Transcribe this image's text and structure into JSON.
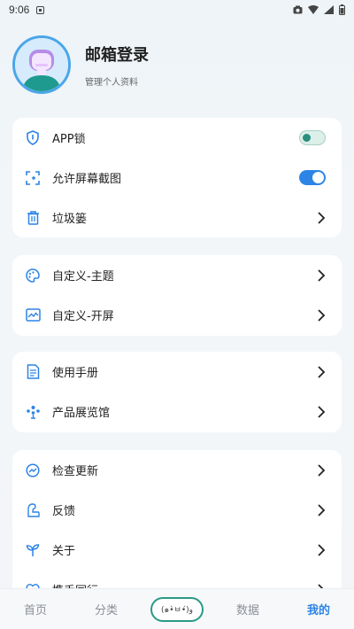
{
  "status_bar": {
    "time": "9:06"
  },
  "profile": {
    "title": "邮箱登录",
    "subtitle": "管理个人资料"
  },
  "groups": [
    {
      "items": [
        {
          "label": "APP锁",
          "icon": "shield-icon",
          "control": "toggle",
          "toggle_on": false
        },
        {
          "label": "允许屏幕截图",
          "icon": "screenshot-icon",
          "control": "toggle",
          "toggle_on": true
        },
        {
          "label": "垃圾篓",
          "icon": "trash-icon",
          "control": "chevron"
        }
      ]
    },
    {
      "items": [
        {
          "label": "自定义-主题",
          "icon": "palette-icon",
          "control": "chevron"
        },
        {
          "label": "自定义-开屏",
          "icon": "splash-icon",
          "control": "chevron"
        }
      ]
    },
    {
      "items": [
        {
          "label": "使用手册",
          "icon": "manual-icon",
          "control": "chevron"
        },
        {
          "label": "产品展览馆",
          "icon": "gallery-icon",
          "control": "chevron"
        }
      ]
    },
    {
      "items": [
        {
          "label": "检查更新",
          "icon": "update-icon",
          "control": "chevron"
        },
        {
          "label": "反馈",
          "icon": "feedback-icon",
          "control": "chevron"
        },
        {
          "label": "关于",
          "icon": "sprout-icon",
          "control": "chevron"
        },
        {
          "label": "携手同行",
          "icon": "heart-icon",
          "control": "chevron"
        }
      ]
    }
  ],
  "bottom_nav": {
    "home": "首页",
    "category": "分类",
    "center": "(๑•̀ㅂ•́)و",
    "data": "数据",
    "mine": "我的"
  },
  "colors": {
    "accent": "#2c84e6",
    "toggle_off_knob": "#2a8f7d",
    "center_border": "#2a9a86"
  }
}
